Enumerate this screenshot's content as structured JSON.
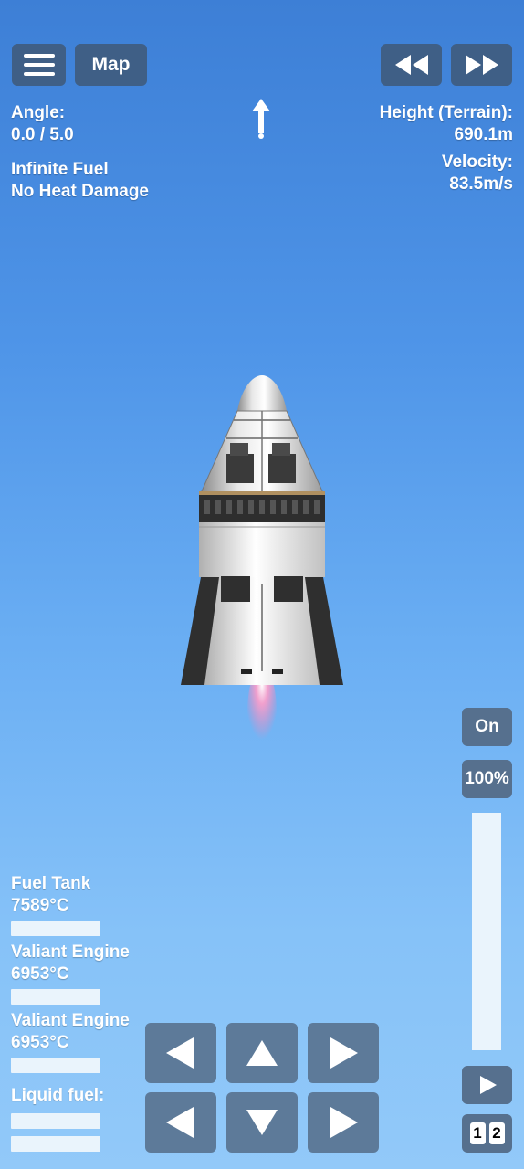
{
  "topbar": {
    "menu_icon": "hamburger-menu-icon",
    "map_label": "Map",
    "rewind_icon": "rewind-icon",
    "fast_forward_icon": "fast-forward-icon",
    "direction_icon": "up-arrow-icon"
  },
  "hud": {
    "angle_label": "Angle:",
    "angle_value": "0.0 / 5.0",
    "cheat_1": "Infinite Fuel",
    "cheat_2": "No Heat Damage",
    "height_label": "Height (Terrain):",
    "height_value": "690.1m",
    "velocity_label": "Velocity:",
    "velocity_value": "83.5m/s"
  },
  "throttle": {
    "engine_toggle": "On",
    "percent": "100%",
    "level": 1.0,
    "play_icon": "play-icon",
    "stage_1": "1",
    "stage_2": "2"
  },
  "parts": [
    {
      "name": "Fuel Tank",
      "temp": "7589°C"
    },
    {
      "name": "Valiant Engine",
      "temp": "6953°C"
    },
    {
      "name": "Valiant Engine",
      "temp": "6953°C"
    }
  ],
  "liquid_fuel_label": "Liquid fuel:",
  "controls": {
    "rotate_left": "left-arrow-icon",
    "up": "up-arrow-icon",
    "rotate_right": "right-arrow-icon",
    "left": "left-arrow-icon",
    "down": "down-arrow-icon",
    "right": "right-arrow-icon"
  },
  "colors": {
    "button": "#3f5f86",
    "control_button": "#5d7a99",
    "sky_top": "#3d7fd6",
    "sky_bottom": "#92c9f9"
  }
}
